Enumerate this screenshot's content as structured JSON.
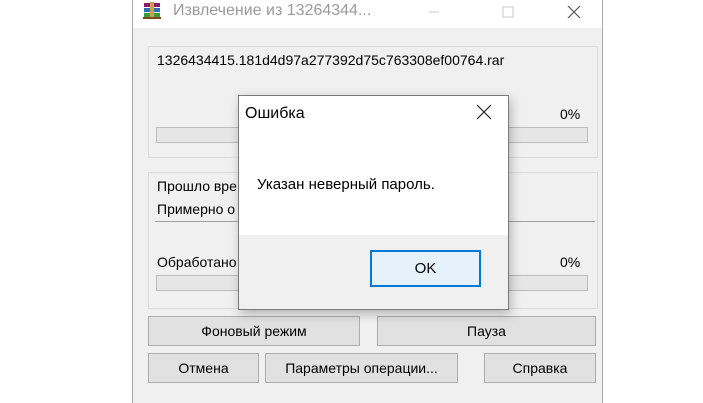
{
  "window": {
    "title": "Извлечение из 13264344...",
    "file_name": "1326434415.181d4d97a277392d75c763308ef00764.rar",
    "file_progress_text": "0%",
    "file_progress": 0,
    "elapsed_label": "Прошло вре",
    "remaining_label": "Примерно о",
    "processed_label": "Обработано",
    "total_progress_text": "0%",
    "total_progress": 0,
    "buttons": {
      "background": "Фоновый режим",
      "pause": "Пауза",
      "cancel": "Отмена",
      "params": "Параметры операции...",
      "help": "Справка"
    }
  },
  "dialog": {
    "title": "Ошибка",
    "message": "Указан неверный пароль.",
    "ok": "OK"
  },
  "colors": {
    "accent": "#0078d7",
    "progress_fill": "#06b025"
  },
  "icons": [
    "winrar-app-icon",
    "minimize-icon",
    "maximize-icon",
    "close-icon"
  ]
}
